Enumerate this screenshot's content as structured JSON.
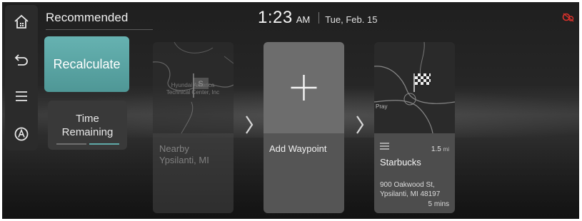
{
  "header": {
    "title": "Recommended",
    "time": "1:23",
    "ampm": "AM",
    "date": "Tue, Feb. 15"
  },
  "sidebar": {
    "items": [
      {
        "icon": "home-icon"
      },
      {
        "icon": "back-icon"
      },
      {
        "icon": "menu-icon"
      },
      {
        "icon": "navigation-icon"
      }
    ]
  },
  "actions": {
    "recalculate": "Recalculate",
    "time_remaining_line1": "Time",
    "time_remaining_line2": "Remaining"
  },
  "cards": {
    "nearby": {
      "map_label_line1": "Hyundai America",
      "map_label_line2": "Technical Center, Inc",
      "badge": "S",
      "label_line1": "Nearby",
      "label_line2": "Ypsilanti, MI"
    },
    "add": {
      "label": "Add Waypoint"
    },
    "destination": {
      "map_label": "Pray",
      "name": "Starbucks",
      "distance": "1.5",
      "distance_unit": "mi",
      "address_line1": "900 Oakwood St,",
      "address_line2": "Ypsilanti, MI 48197",
      "eta": "5 mins"
    }
  },
  "colors": {
    "accent": "#5fa9a8",
    "status_red": "#d9312b"
  }
}
